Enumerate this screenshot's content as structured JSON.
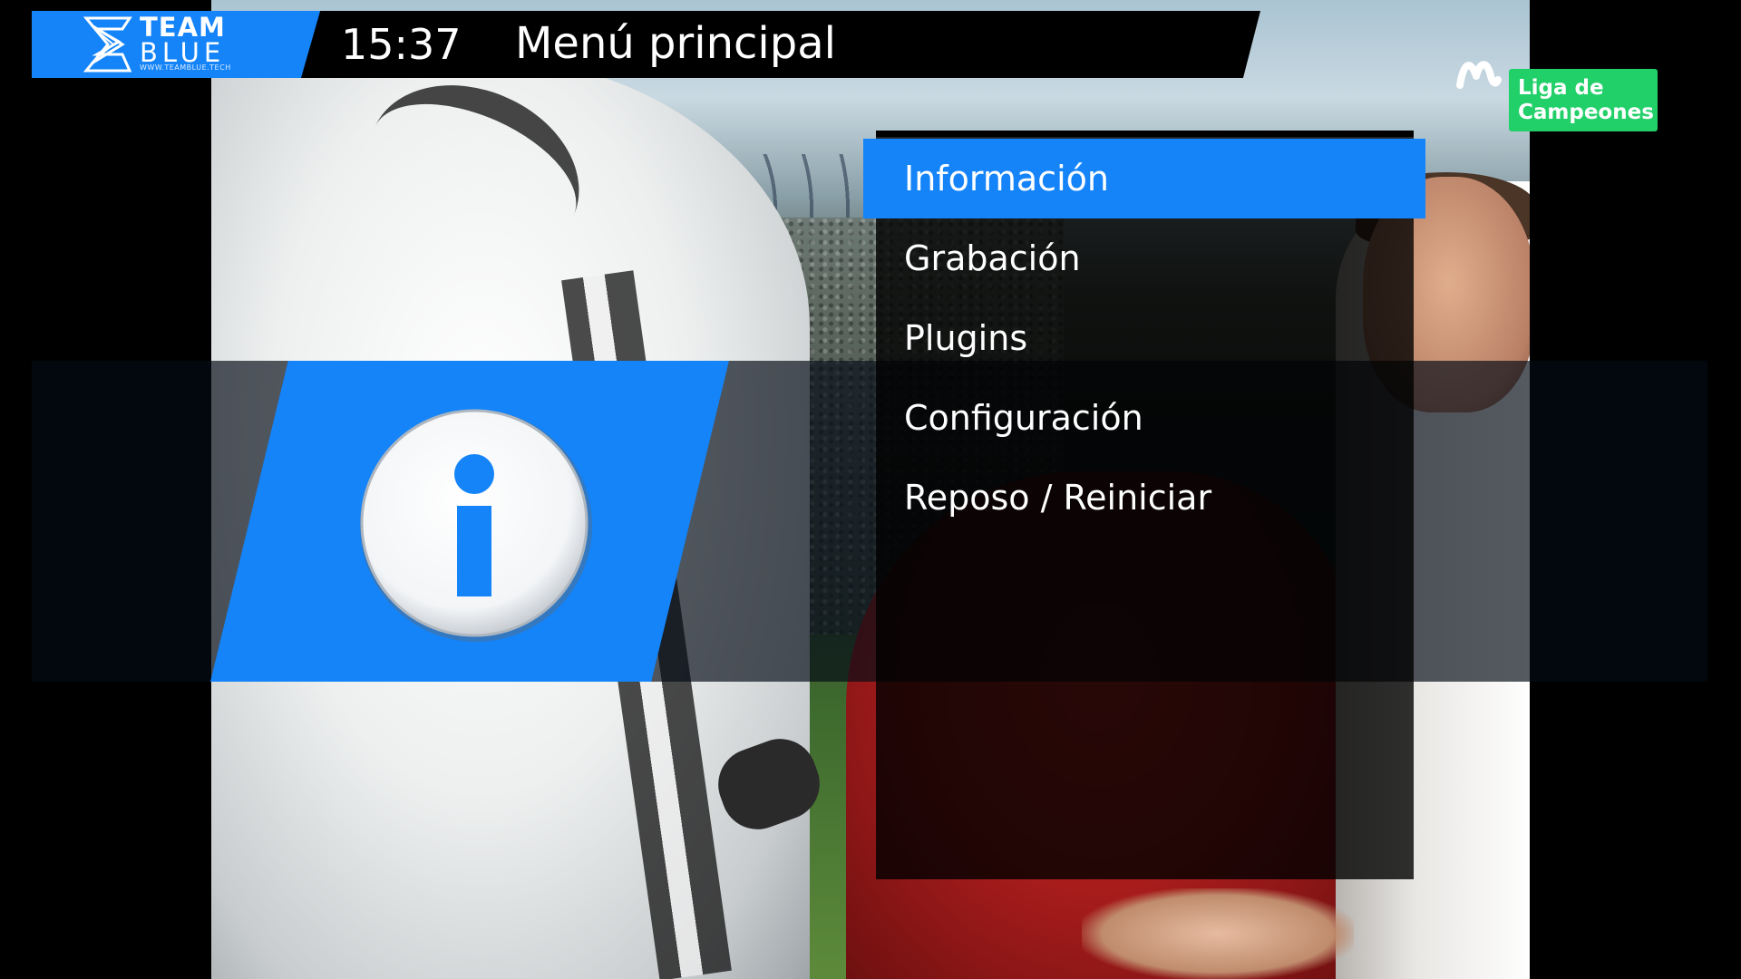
{
  "header": {
    "brand": {
      "name_line1": "TEAM",
      "name_line2": "BLUE",
      "url": "WWW.TEAMBLUE.TECH"
    },
    "clock": "15:37",
    "title": "Menú principal"
  },
  "menu": {
    "selected_index": 0,
    "items": [
      {
        "label": "Información"
      },
      {
        "label": "Grabación"
      },
      {
        "label": "Plugins"
      },
      {
        "label": "Configuración"
      },
      {
        "label": "Reposo / Reiniciar"
      }
    ]
  },
  "preview": {
    "icon": "info-icon"
  },
  "channel": {
    "logo": "movistar-logo",
    "badge_line1": "Liga de",
    "badge_line2": "Campeones"
  },
  "colors": {
    "accent": "#1484f8",
    "panel": "#000000",
    "channel_badge": "#22d06a",
    "text": "#ffffff"
  }
}
